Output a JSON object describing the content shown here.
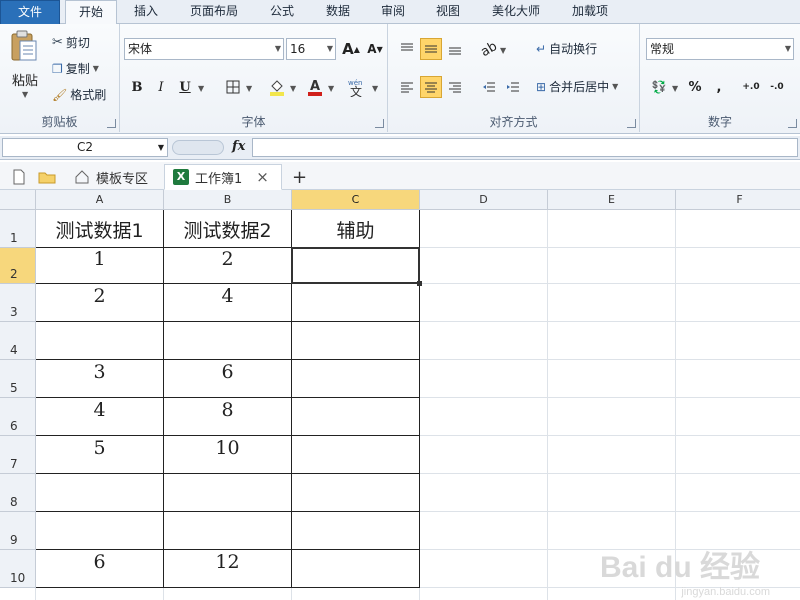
{
  "ribbon_tabs": [
    "文件",
    "开始",
    "插入",
    "页面布局",
    "公式",
    "数据",
    "审阅",
    "视图",
    "美化大师",
    "加载项"
  ],
  "clipboard": {
    "paste": "粘贴",
    "cut": "剪切",
    "copy": "复制",
    "format_painter": "格式刷",
    "group_label": "剪贴板"
  },
  "font": {
    "name": "宋体",
    "size": "16",
    "group_label": "字体",
    "bold": "B",
    "italic": "I",
    "underline": "U",
    "grow": "A",
    "shrink": "A"
  },
  "alignment": {
    "wrap": "自动换行",
    "merge": "合并后居中",
    "group_label": "对齐方式"
  },
  "number": {
    "format": "常规",
    "group_label": "数字",
    "percent": "%",
    "comma": ",",
    "inc_decimal": "+.0",
    "dec_decimal": "-.0"
  },
  "formula_bar": {
    "name_box": "C2",
    "fx": "fx",
    "content": ""
  },
  "doc_tabs": {
    "template": "模板专区",
    "workbook": "工作簿1",
    "close": "×",
    "add": "+"
  },
  "sheet": {
    "columns": [
      "A",
      "B",
      "C",
      "D",
      "E",
      "F"
    ],
    "rows": [
      "1",
      "2",
      "3",
      "4",
      "5",
      "6",
      "7",
      "8",
      "9",
      "10"
    ],
    "cells": [
      [
        "测试数据1",
        "测试数据2",
        "辅助"
      ],
      [
        "1",
        "2",
        ""
      ],
      [
        "2",
        "4",
        ""
      ],
      [
        "",
        "",
        ""
      ],
      [
        "3",
        "6",
        ""
      ],
      [
        "4",
        "8",
        ""
      ],
      [
        "5",
        "10",
        ""
      ],
      [
        "",
        "",
        ""
      ],
      [
        "",
        "",
        ""
      ],
      [
        "6",
        "12",
        ""
      ]
    ],
    "active_cell": "C2"
  },
  "watermark": {
    "main": "Bai du 经验",
    "sub": "jingyan.baidu.com"
  },
  "colors": {
    "file_tab": "#2a70b9",
    "selected_header": "#f7d77c",
    "highlight": "#ffd56a",
    "font_color": "#d0201b",
    "fill_color": "#f2e64c"
  }
}
